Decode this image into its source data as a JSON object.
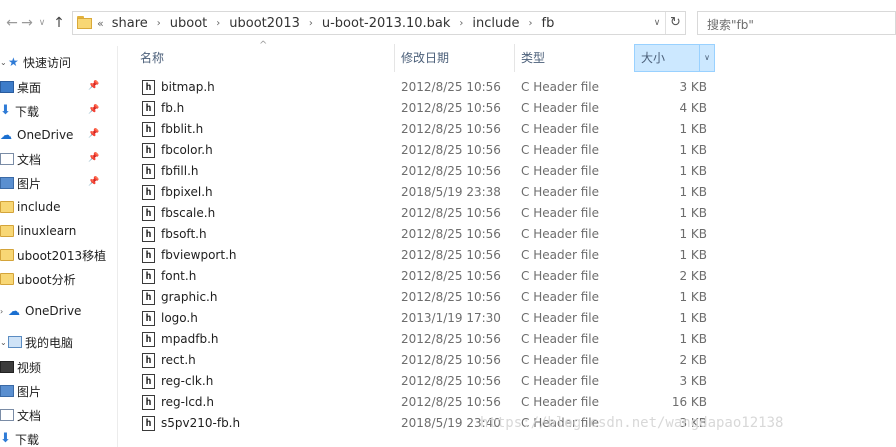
{
  "nav": {
    "back": "←",
    "forward": "→",
    "recent": "∨",
    "up": "↑"
  },
  "breadcrumb": [
    "share",
    "uboot",
    "uboot2013",
    "u-boot-2013.10.bak",
    "include",
    "fb"
  ],
  "search": {
    "placeholder": "搜索\"fb\""
  },
  "sidebar": {
    "items": [
      {
        "label": "快速访问",
        "icon": "star-icon"
      },
      {
        "label": "桌面",
        "icon": "desktop-icon",
        "pinned": true
      },
      {
        "label": "下载",
        "icon": "download-icon",
        "pinned": true
      },
      {
        "label": "OneDrive",
        "icon": "onedrive-icon",
        "pinned": true
      },
      {
        "label": "文档",
        "icon": "documents-icon",
        "pinned": true
      },
      {
        "label": "图片",
        "icon": "pictures-icon",
        "pinned": true
      },
      {
        "label": "include",
        "icon": "folder-icon"
      },
      {
        "label": "linuxlearn",
        "icon": "folder-icon"
      },
      {
        "label": "uboot2013移植",
        "icon": "folder-icon"
      },
      {
        "label": "uboot分析",
        "icon": "folder-icon"
      },
      {
        "label": "OneDrive",
        "icon": "onedrive-icon"
      },
      {
        "label": "我的电脑",
        "icon": "computer-icon"
      },
      {
        "label": "视频",
        "icon": "video-icon"
      },
      {
        "label": "图片",
        "icon": "pictures-icon"
      },
      {
        "label": "文档",
        "icon": "documents-icon"
      },
      {
        "label": "下载",
        "icon": "download-icon"
      }
    ]
  },
  "columns": {
    "name": "名称",
    "date": "修改日期",
    "type": "类型",
    "size": "大小"
  },
  "files": [
    {
      "name": "bitmap.h",
      "date": "2012/8/25 10:56",
      "type": "C Header file",
      "size": "3 KB"
    },
    {
      "name": "fb.h",
      "date": "2012/8/25 10:56",
      "type": "C Header file",
      "size": "4 KB"
    },
    {
      "name": "fbblit.h",
      "date": "2012/8/25 10:56",
      "type": "C Header file",
      "size": "1 KB"
    },
    {
      "name": "fbcolor.h",
      "date": "2012/8/25 10:56",
      "type": "C Header file",
      "size": "1 KB"
    },
    {
      "name": "fbfill.h",
      "date": "2012/8/25 10:56",
      "type": "C Header file",
      "size": "1 KB"
    },
    {
      "name": "fbpixel.h",
      "date": "2018/5/19 23:38",
      "type": "C Header file",
      "size": "1 KB"
    },
    {
      "name": "fbscale.h",
      "date": "2012/8/25 10:56",
      "type": "C Header file",
      "size": "1 KB"
    },
    {
      "name": "fbsoft.h",
      "date": "2012/8/25 10:56",
      "type": "C Header file",
      "size": "1 KB"
    },
    {
      "name": "fbviewport.h",
      "date": "2012/8/25 10:56",
      "type": "C Header file",
      "size": "1 KB"
    },
    {
      "name": "font.h",
      "date": "2012/8/25 10:56",
      "type": "C Header file",
      "size": "2 KB"
    },
    {
      "name": "graphic.h",
      "date": "2012/8/25 10:56",
      "type": "C Header file",
      "size": "1 KB"
    },
    {
      "name": "logo.h",
      "date": "2013/1/19 17:30",
      "type": "C Header file",
      "size": "1 KB"
    },
    {
      "name": "mpadfb.h",
      "date": "2012/8/25 10:56",
      "type": "C Header file",
      "size": "1 KB"
    },
    {
      "name": "rect.h",
      "date": "2012/8/25 10:56",
      "type": "C Header file",
      "size": "2 KB"
    },
    {
      "name": "reg-clk.h",
      "date": "2012/8/25 10:56",
      "type": "C Header file",
      "size": "3 KB"
    },
    {
      "name": "reg-lcd.h",
      "date": "2012/8/25 10:56",
      "type": "C Header file",
      "size": "16 KB"
    },
    {
      "name": "s5pv210-fb.h",
      "date": "2018/5/19 23:40",
      "type": "C Header file",
      "size": "3 KB"
    }
  ],
  "watermark": "https://blog.csdn.net/wangdapao12138",
  "colors": {
    "selected_header": "#cce8ff",
    "folder": "#f8d775",
    "accent": "#2f7bd6"
  }
}
